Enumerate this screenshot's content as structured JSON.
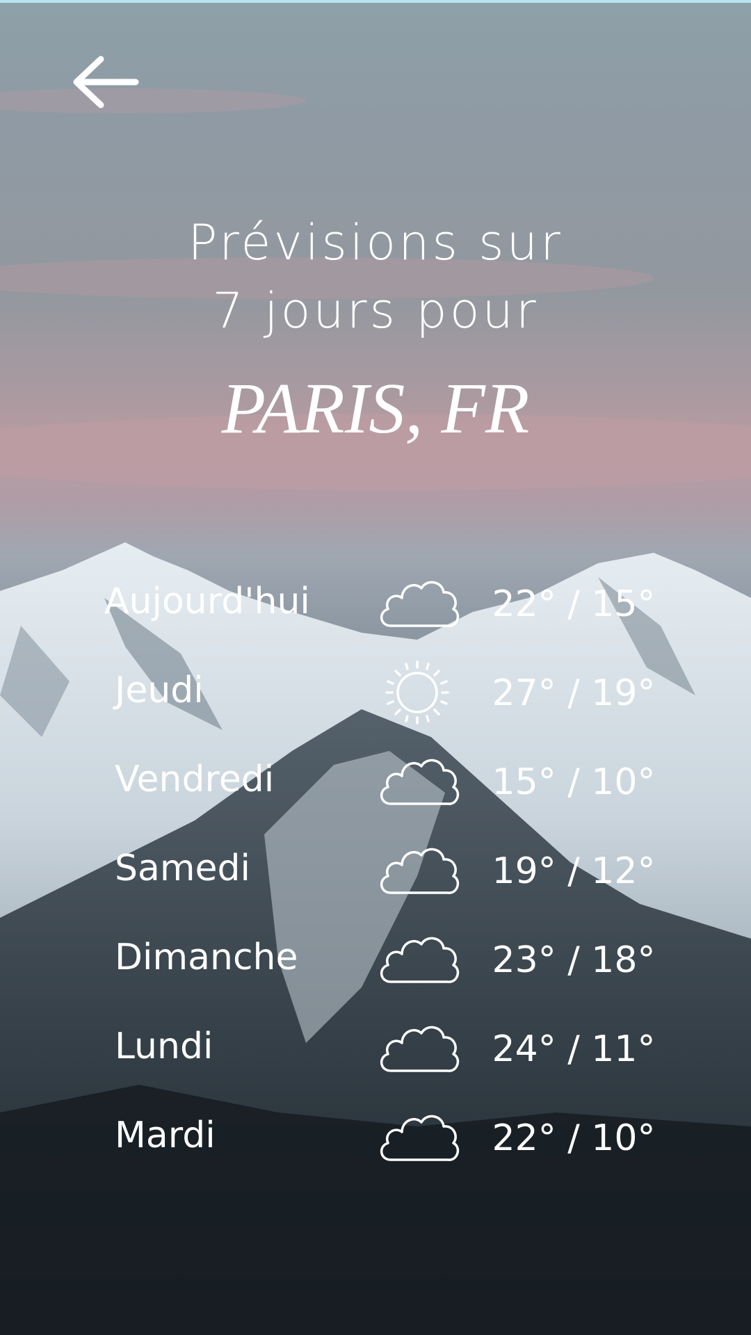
{
  "header": {
    "back_icon": "arrow-left-icon",
    "title_line1": "Prévisions sur",
    "title_line2": "7 jours pour",
    "city": "PARIS, FR"
  },
  "forecast": [
    {
      "day": "Aujourd'hui",
      "icon": "cloud-icon",
      "temps": "22° / 15°"
    },
    {
      "day": "Jeudi",
      "icon": "sun-icon",
      "temps": "27° / 19°"
    },
    {
      "day": "Vendredi",
      "icon": "cloud-icon",
      "temps": "15° / 10°"
    },
    {
      "day": "Samedi",
      "icon": "cloud-icon",
      "temps": "19° / 12°"
    },
    {
      "day": "Dimanche",
      "icon": "cloud-icon",
      "temps": "23° / 18°"
    },
    {
      "day": "Lundi",
      "icon": "cloud-icon",
      "temps": "24° / 11°"
    },
    {
      "day": "Mardi",
      "icon": "cloud-icon",
      "temps": "22° / 10°"
    }
  ],
  "colors": {
    "text": "#ffffff",
    "sky": "#8f9aa4",
    "sunset_band": "#b79ca2",
    "snow": "#dfe7ee",
    "forest": "#1e262d"
  }
}
